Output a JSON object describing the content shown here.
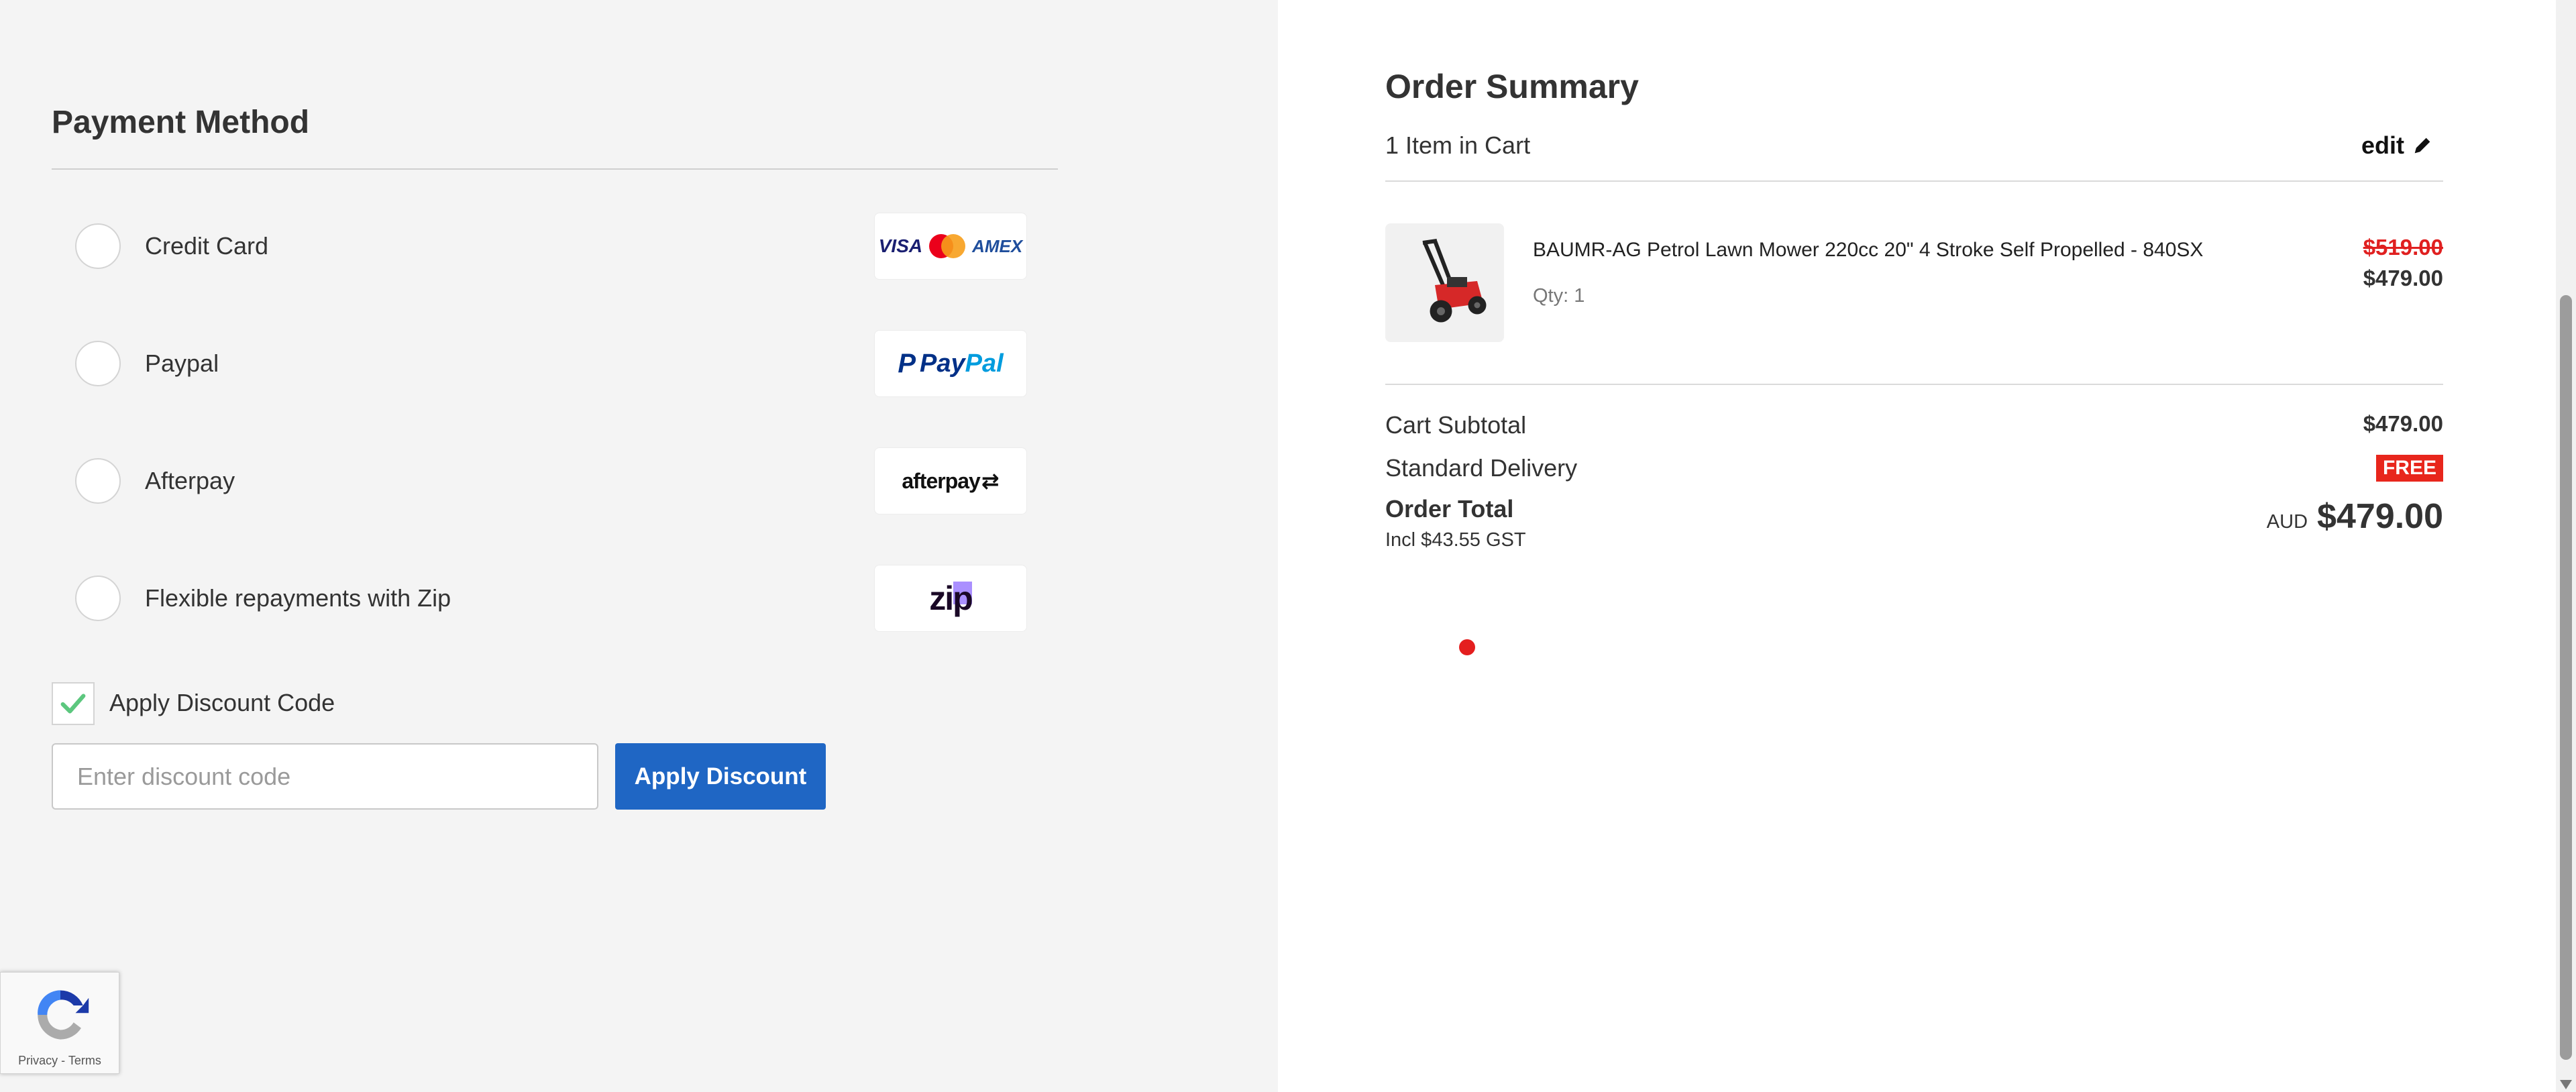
{
  "payment": {
    "title": "Payment Method",
    "options": [
      {
        "label": "Credit Card",
        "logo": "card-logos-icon"
      },
      {
        "label": "Paypal",
        "logo": "paypal-logo"
      },
      {
        "label": "Afterpay",
        "logo": "afterpay-logo"
      },
      {
        "label": "Flexible repayments with Zip",
        "logo": "zip-logo"
      }
    ],
    "logos": {
      "visa": "VISA",
      "amex": "AMEX",
      "paypal_pay": "Pay",
      "paypal_pal": "Pal",
      "afterpay": "afterpay",
      "zip": "zip"
    },
    "discount": {
      "checkbox_label": "Apply Discount Code",
      "checked": true,
      "input_placeholder": "Enter discount code",
      "input_value": "",
      "button_label": "Apply Discount"
    }
  },
  "recaptcha": {
    "links": "Privacy - Terms"
  },
  "summary": {
    "title": "Order Summary",
    "item_count": "1 Item in Cart",
    "edit_label": "edit",
    "item": {
      "name": "BAUMR-AG Petrol Lawn Mower 220cc 20\" 4 Stroke Self Propelled - 840SX",
      "qty": "Qty: 1",
      "price_old": "$519.00",
      "price_new": "$479.00"
    },
    "subtotal_label": "Cart Subtotal",
    "subtotal_value": "$479.00",
    "delivery_label": "Standard Delivery",
    "delivery_value": "FREE",
    "total_label": "Order Total",
    "gst_label": "Incl $43.55 GST",
    "total_currency": "AUD",
    "total_value": "$479.00"
  },
  "colors": {
    "accent": "#1f66c4",
    "sale_red": "#e02020",
    "free_badge": "#e8261c",
    "check_green": "#5cc77e",
    "left_bg": "#f4f4f4"
  }
}
